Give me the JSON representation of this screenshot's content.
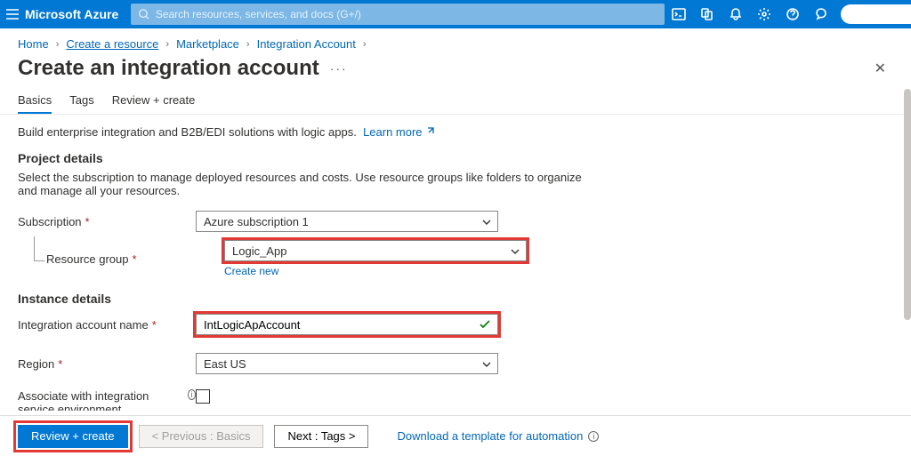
{
  "brand": "Microsoft Azure",
  "search": {
    "placeholder": "Search resources, services, and docs (G+/)"
  },
  "breadcrumbs": {
    "items": [
      "Home",
      "Create a resource",
      "Marketplace",
      "Integration Account"
    ]
  },
  "page": {
    "title": "Create an integration account",
    "tabs": [
      "Basics",
      "Tags",
      "Review + create"
    ],
    "active_tab_index": 0,
    "intro_text": "Build enterprise integration and B2B/EDI solutions with logic apps.",
    "learn_more": "Learn more"
  },
  "project_details": {
    "heading": "Project details",
    "description": "Select the subscription to manage deployed resources and costs. Use resource groups like folders to organize and manage all your resources.",
    "subscription_label": "Subscription",
    "subscription_value": "Azure subscription 1",
    "resource_group_label": "Resource group",
    "resource_group_value": "Logic_App",
    "create_new": "Create new"
  },
  "instance_details": {
    "heading": "Instance details",
    "name_label": "Integration account name",
    "name_value": "IntLogicApAccount",
    "region_label": "Region",
    "region_value": "East US",
    "associate_label": "Associate with integration service environment"
  },
  "footer": {
    "review_create": "Review + create",
    "previous": "< Previous : Basics",
    "next": "Next : Tags >",
    "download_template": "Download a template for automation"
  }
}
